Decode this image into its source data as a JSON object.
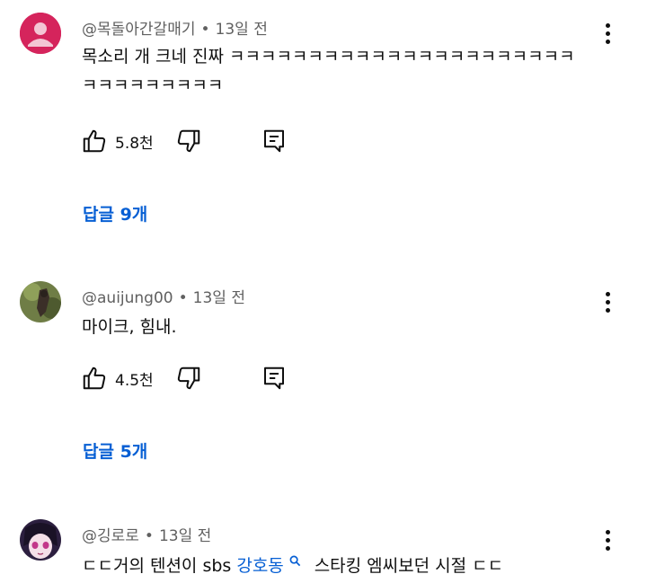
{
  "comments": [
    {
      "author": "@목돌아간갈매기",
      "separator": "•",
      "time": "13일 전",
      "text": "목소리 개 크네 진짜 ㅋㅋㅋㅋㅋㅋㅋㅋㅋㅋㅋㅋㅋㅋㅋㅋㅋㅋㅋㅋㅋㅋㅋㅋㅋㅋㅋㅋㅋㅋㅋ",
      "likes": "5.8천",
      "replies": "답글 9개",
      "avatar_color": "#d5245c"
    },
    {
      "author": "@auijung00",
      "separator": "•",
      "time": "13일 전",
      "text": "마이크, 힘내.",
      "likes": "4.5천",
      "replies": "답글 5개",
      "avatar_color": "#5a6b3a"
    },
    {
      "author": "@깅로로",
      "separator": "•",
      "time": "13일 전",
      "text_before": "ㄷㄷ거의 텐션이 sbs ",
      "text_link": "강호동",
      "text_after": "스타킹 엠씨보던 시절 ㄷㄷ",
      "avatar_color": "#3b2a52"
    }
  ],
  "icons": {
    "like": "thumb-up-icon",
    "dislike": "thumb-down-icon",
    "reply": "comment-reply-icon",
    "more": "more-vertical-icon",
    "search": "search-icon"
  },
  "colors": {
    "link": "#065fd4",
    "meta": "#606060",
    "text": "#0f0f0f"
  }
}
